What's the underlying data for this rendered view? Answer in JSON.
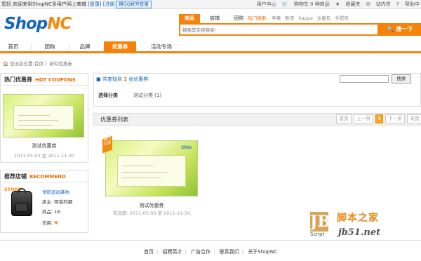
{
  "topbar": {
    "welcome": "您好,欢迎来到ShopNC多用户网上商城",
    "login": "[登录]",
    "register": "[注册]",
    "qq_login": "用QQ帐号登录",
    "user_center": "用户中心",
    "cart": "购物车 0 种商品",
    "favorites": "收藏夹",
    "site_nav": "站内信",
    "help": "帮助中"
  },
  "logo": {
    "part1": "Shop",
    "part2": "NC"
  },
  "search": {
    "tabs": [
      "商品",
      "店铺",
      "团购"
    ],
    "hot_label": "热门搜索:",
    "hot_words": [
      "苹果",
      "耐克",
      "Kappa",
      "达能包",
      "手提包"
    ],
    "placeholder": "搜索其实很容易!",
    "button": "搜一下"
  },
  "nav": {
    "items": [
      "首页",
      "团购",
      "品牌",
      "优惠券",
      "活动专场"
    ]
  },
  "breadcrumb": "您当前位置:首页 〉新有优惠券",
  "left": {
    "hot_title": "热门优惠券",
    "hot_sub": "HOT COUPONS",
    "hot_coupon_name": "测试优惠券",
    "hot_coupon_date": "2011-05-03 至 2011-11-30",
    "rec_title": "推荐店铺",
    "rec_sub": "RECOMMEND",
    "store_logo": "STORE",
    "store_name": "领航运动基地",
    "store_owner": "店主: 阿菲的拥",
    "store_goods": "商品: 18",
    "store_credit": "信用:"
  },
  "main": {
    "result_prefix": "共查找到",
    "result_count": "1",
    "result_suffix": "张优惠券",
    "search_button": "搜索",
    "category_label": "选择分类",
    "category_item": "测试分类 (1)",
    "list_title": "优惠券列表",
    "pager": {
      "first": "首页",
      "prev": "上一页",
      "current": "1",
      "next": "下一页",
      "last": "末页"
    },
    "badge": "热门优惠",
    "coupon_stamp": "Chin",
    "coupon_name": "测试优惠券",
    "coupon_validity": "有效期: 2011-05-03 至 2011-11-30"
  },
  "footer": {
    "links": [
      "首页",
      "招聘英才",
      "广告合作",
      "联系我们",
      "关于ShopNC"
    ]
  },
  "watermark": {
    "logo": "JB",
    "script": "Script",
    "cn": "脚本之家",
    "url": "jb51.net"
  },
  "colors": {
    "accent": "#f5820a",
    "brand_blue": "#1565c0"
  }
}
